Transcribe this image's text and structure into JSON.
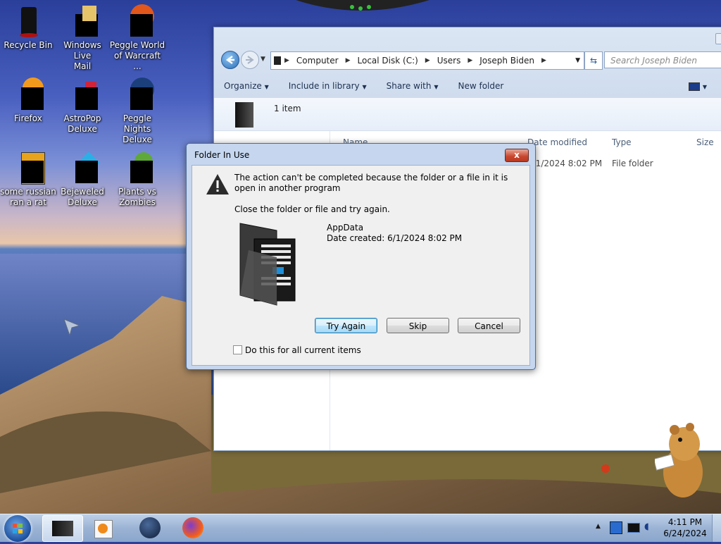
{
  "desktop": {
    "icons": [
      {
        "label": "Recycle Bin"
      },
      {
        "label": "Windows Live\nMail"
      },
      {
        "label": "Peggle World\nof Warcraft ..."
      },
      {
        "label": "Firefox"
      },
      {
        "label": "AstroPop\nDeluxe"
      },
      {
        "label": "Peggle Nights\nDeluxe"
      },
      {
        "label": "some russian\nran a rat"
      },
      {
        "label": "Bejeweled\nDeluxe"
      },
      {
        "label": "Plants vs\nZombies"
      }
    ]
  },
  "explorer": {
    "breadcrumb": [
      "Computer",
      "Local Disk (C:)",
      "Users",
      "Joseph Biden"
    ],
    "search_placeholder": "Search Joseph Biden",
    "commands": [
      "Organize",
      "Include in library",
      "Share with",
      "New folder"
    ],
    "item_count": "1 item",
    "columns": [
      "Name",
      "Date modified",
      "Type",
      "Size"
    ],
    "row": {
      "date": "6/1/2024 8:02 PM",
      "type": "File folder"
    }
  },
  "dialog": {
    "title": "Folder In Use",
    "message": "The action can't be completed because the folder or a file in it is open in another program",
    "instruction": "Close the folder or file and try again.",
    "file_name": "AppData",
    "file_date": "Date created: 6/1/2024 8:02 PM",
    "buttons": {
      "try_again": "Try Again",
      "skip": "Skip",
      "cancel": "Cancel"
    },
    "checkbox_label": "Do this for all current items",
    "close_glyph": "x"
  },
  "taskbar": {
    "time": "4:11 PM",
    "date": "6/24/2024"
  }
}
